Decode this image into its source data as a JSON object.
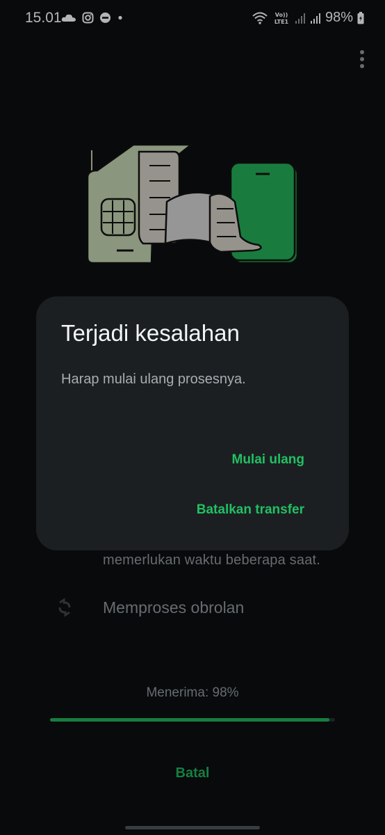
{
  "status_bar": {
    "time": "15.01",
    "battery_percent": "98%",
    "network_label": "Vo)) LTE1",
    "left_icons": [
      "cloud-icon",
      "instagram-icon",
      "do-not-disturb-icon",
      "dot-icon"
    ],
    "right_icons": [
      "wifi-icon",
      "volte-lte-icon",
      "signal-icon",
      "signal-icon",
      "battery-charging-icon"
    ]
  },
  "toolbar": {
    "menu_icon": "more-vert-icon"
  },
  "background": {
    "subtext": "memerlukan waktu beberapa saat.",
    "processing_label": "Memproses obrolan",
    "processing_icon": "sync-icon",
    "progress_label": "Menerima: 98%",
    "progress_value": 0.98,
    "cancel_label": "Batal"
  },
  "dialog": {
    "title": "Terjadi kesalahan",
    "message": "Harap mulai ulang prosesnya.",
    "restart_label": "Mulai ulang",
    "cancel_transfer_label": "Batalkan transfer"
  },
  "colors": {
    "accent": "#21c063",
    "background": "#0b0e10",
    "dialog": "#1c1f22"
  }
}
